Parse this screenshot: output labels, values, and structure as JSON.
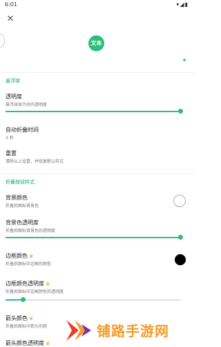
{
  "status_bar": {
    "time": "6:01",
    "icons": "▾◢▮"
  },
  "header": {
    "close_icon": "✕",
    "preview_label": "文本"
  },
  "sections": {
    "float_ball": {
      "title": "悬浮球",
      "transparency": {
        "title": "透明度",
        "desc": "悬浮球显示时的透明度",
        "value": 1.0
      },
      "auto_fold": {
        "title": "自动折叠时间",
        "value": "3 秒"
      },
      "reset": {
        "title": "重置",
        "desc": "清除以上设置，并恢复默认样式"
      }
    },
    "fold_button": {
      "title": "折叠按钮样式",
      "bg_color": {
        "title": "背景颜色",
        "desc": "折叠后图标背景色",
        "color": "#ffffff"
      },
      "bg_transparency": {
        "title": "背景色透明度",
        "desc": "折叠后图标背景色的透明度",
        "value": 1.0
      },
      "border_color": {
        "title": "边框颜色",
        "desc": "折叠后图标中边框的颜色",
        "color": "#000000"
      },
      "border_transparency": {
        "title": "边框颜色透明度",
        "desc": "折叠后图标中边框颜色的透明度",
        "value": 0.1
      },
      "arrow_color": {
        "title": "箭头颜色",
        "desc": "折叠后图标中箭头的颜"
      },
      "arrow_transparency": {
        "title": "箭头颜色透明度"
      }
    }
  },
  "watermark": {
    "text": "铺路手游网"
  },
  "colors": {
    "accent": "#2bbf7a",
    "crown": "#f0a020",
    "watermark": "#f39c2c"
  }
}
